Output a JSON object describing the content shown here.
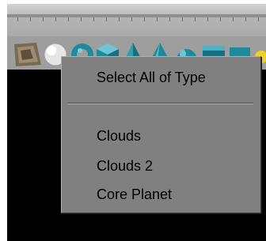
{
  "context_menu": {
    "items": [
      {
        "label": "Select All of Type"
      },
      {
        "label": "Clouds"
      },
      {
        "label": "Clouds 2"
      },
      {
        "label": "Core Planet"
      }
    ]
  },
  "toolbar": {
    "icons": [
      "terrain-icon",
      "sphere-icon",
      "torus-icon",
      "cube-icon",
      "pyramid-icon",
      "cone-icon",
      "dome-icon",
      "box-icon",
      "light-icon"
    ]
  },
  "colors": {
    "menu_background": "#808080",
    "shape_teal": "#1f8a9a",
    "window_background": "#000000"
  }
}
